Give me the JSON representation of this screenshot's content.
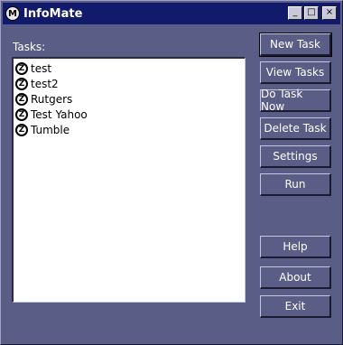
{
  "window": {
    "title": "InfoMate",
    "icon_glyph": "M"
  },
  "title_buttons": {
    "minimize": "_",
    "maximize": "□",
    "close": "×"
  },
  "tasks": {
    "label": "Tasks:",
    "items": [
      {
        "label": "test",
        "icon": "task-z-icon"
      },
      {
        "label": "test2",
        "icon": "task-z-icon"
      },
      {
        "label": "Rutgers",
        "icon": "task-z-icon"
      },
      {
        "label": "Test Yahoo",
        "icon": "task-z-icon"
      },
      {
        "label": "Tumble",
        "icon": "task-z-icon"
      }
    ],
    "icon_glyph": "Z"
  },
  "buttons": {
    "new_task": "New Task",
    "view_tasks": "View Tasks",
    "do_task_now": "Do Task Now",
    "delete_task": "Delete Task",
    "settings": "Settings",
    "run": "Run",
    "help": "Help",
    "about": "About",
    "exit": "Exit"
  },
  "colors": {
    "window_bg": "#5a5d85",
    "titlebar_bg": "#121a6c",
    "list_bg": "#ffffff"
  }
}
